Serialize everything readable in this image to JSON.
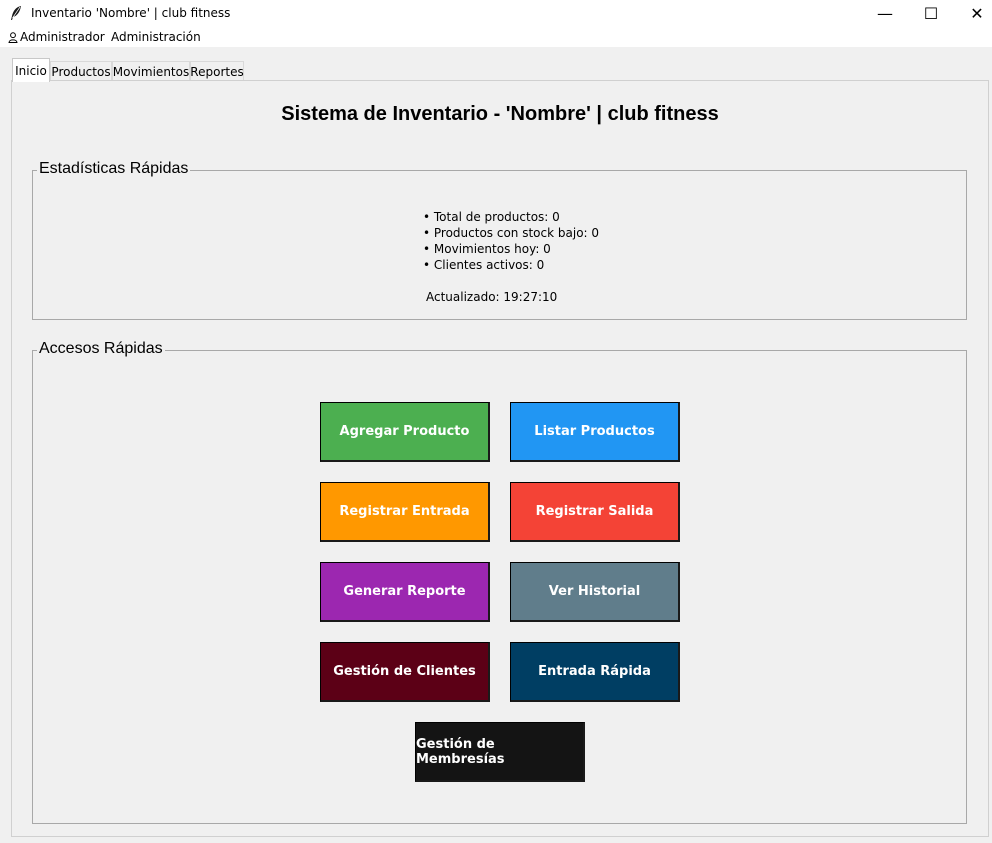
{
  "window": {
    "title": "Inventario 'Nombre' | club fitness",
    "controls": {
      "minimize": "—",
      "maximize": "☐",
      "close": "✕"
    },
    "icon": "feather-icon"
  },
  "menubar": [
    {
      "label": "Administrador",
      "icon": "user-icon"
    },
    {
      "label": "Administración"
    }
  ],
  "tabs": [
    {
      "label": "Inicio",
      "active": true
    },
    {
      "label": "Productos"
    },
    {
      "label": "Movimientos"
    },
    {
      "label": "Reportes"
    }
  ],
  "main": {
    "title": "Sistema de Inventario - 'Nombre' | club fitness",
    "stats": {
      "label": "Estadísticas Rápidas",
      "lines": [
        "• Total de productos: 0",
        "• Productos con stock bajo: 0",
        "• Movimientos hoy: 0",
        "• Clientes activos: 0"
      ],
      "updated": "Actualizado: 19:27:10"
    },
    "quick_access": {
      "label": "Accesos Rápidas",
      "buttons": [
        {
          "label": "Agregar Producto",
          "color": "#4caf50"
        },
        {
          "label": "Listar Productos",
          "color": "#2196f3"
        },
        {
          "label": "Registrar Entrada",
          "color": "#ff9800"
        },
        {
          "label": "Registrar Salida",
          "color": "#f44336"
        },
        {
          "label": "Generar Reporte",
          "color": "#9c27b0"
        },
        {
          "label": "Ver Historial",
          "color": "#607d8b"
        },
        {
          "label": "Gestión de Clientes",
          "color": "#5c0016"
        },
        {
          "label": "Entrada Rápida",
          "color": "#003e63"
        },
        {
          "label": "Gestión de Membresías",
          "color": "#141414"
        }
      ]
    }
  }
}
